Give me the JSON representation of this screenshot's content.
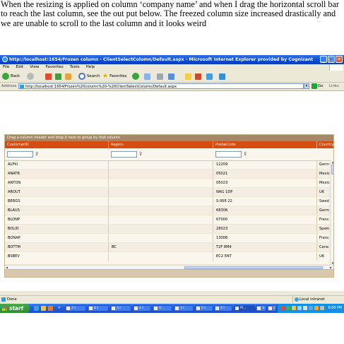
{
  "caption": "When the resizing is applied on column ‘company name’ and when I drag the horizontal scroll bar to reach the last column, see the out put below. The freezed column size increased drastically and we are unable to scroll to the last column and it looks weird",
  "window": {
    "title": "http://localhost:1654/Frozen column - ClientSelectColumn/Default.aspx - Microsoft Internet Explorer provided by Cognizant",
    "controls": [
      "_",
      "□",
      "✕"
    ]
  },
  "menu": [
    "File",
    "Edit",
    "View",
    "Favorites",
    "Tools",
    "Help"
  ],
  "toolbar": {
    "back": "Back",
    "search": "Search",
    "favorites": "Favorites"
  },
  "address": {
    "label": "Address",
    "url": "http://localhost:1654/Frozen%20column%20-%20ClientSelectColumn/Default.aspx",
    "go": "Go",
    "links": "Links"
  },
  "grid": {
    "group_panel": "Drag a column header and drop it here to group by that column",
    "columns": [
      "CustomerID",
      "Region",
      "PostalCode",
      "Country"
    ],
    "rows": [
      [
        "ALFKI",
        "",
        "12209",
        "Germ"
      ],
      [
        "ANATR",
        "",
        "05021",
        "Mexic"
      ],
      [
        "ANTON",
        "",
        "05023",
        "Mexic"
      ],
      [
        "AROUT",
        "",
        "WA1 1DP",
        "UK"
      ],
      [
        "BERGS",
        "",
        "S-958 22",
        "Swed"
      ],
      [
        "BLAUS",
        "",
        "68306",
        "Germ"
      ],
      [
        "BLONP",
        "",
        "67000",
        "Franc"
      ],
      [
        "BOLID",
        "",
        "28023",
        "Spain"
      ],
      [
        "BONAP",
        "",
        "13008",
        "Franc"
      ],
      [
        "BOTTM",
        "BC",
        "T2F 8M4",
        "Cana"
      ],
      [
        "BSBEV",
        "",
        "EC2 5NT",
        "UK"
      ]
    ]
  },
  "status": {
    "text": "Done",
    "zone": "Local intranet"
  },
  "taskbar": {
    "start": "start",
    "tasks": [
      "3 I",
      "4 I",
      "3 I",
      "2 I",
      "V...",
      "3 I",
      "2 I",
      "2 I",
      "Pl...",
      "3 I",
      "2 I"
    ],
    "clock": "8:00 PM"
  },
  "colors": {
    "header": "#d64b10",
    "group_panel": "#a5876a",
    "title_bar": "#0b4bd5"
  }
}
